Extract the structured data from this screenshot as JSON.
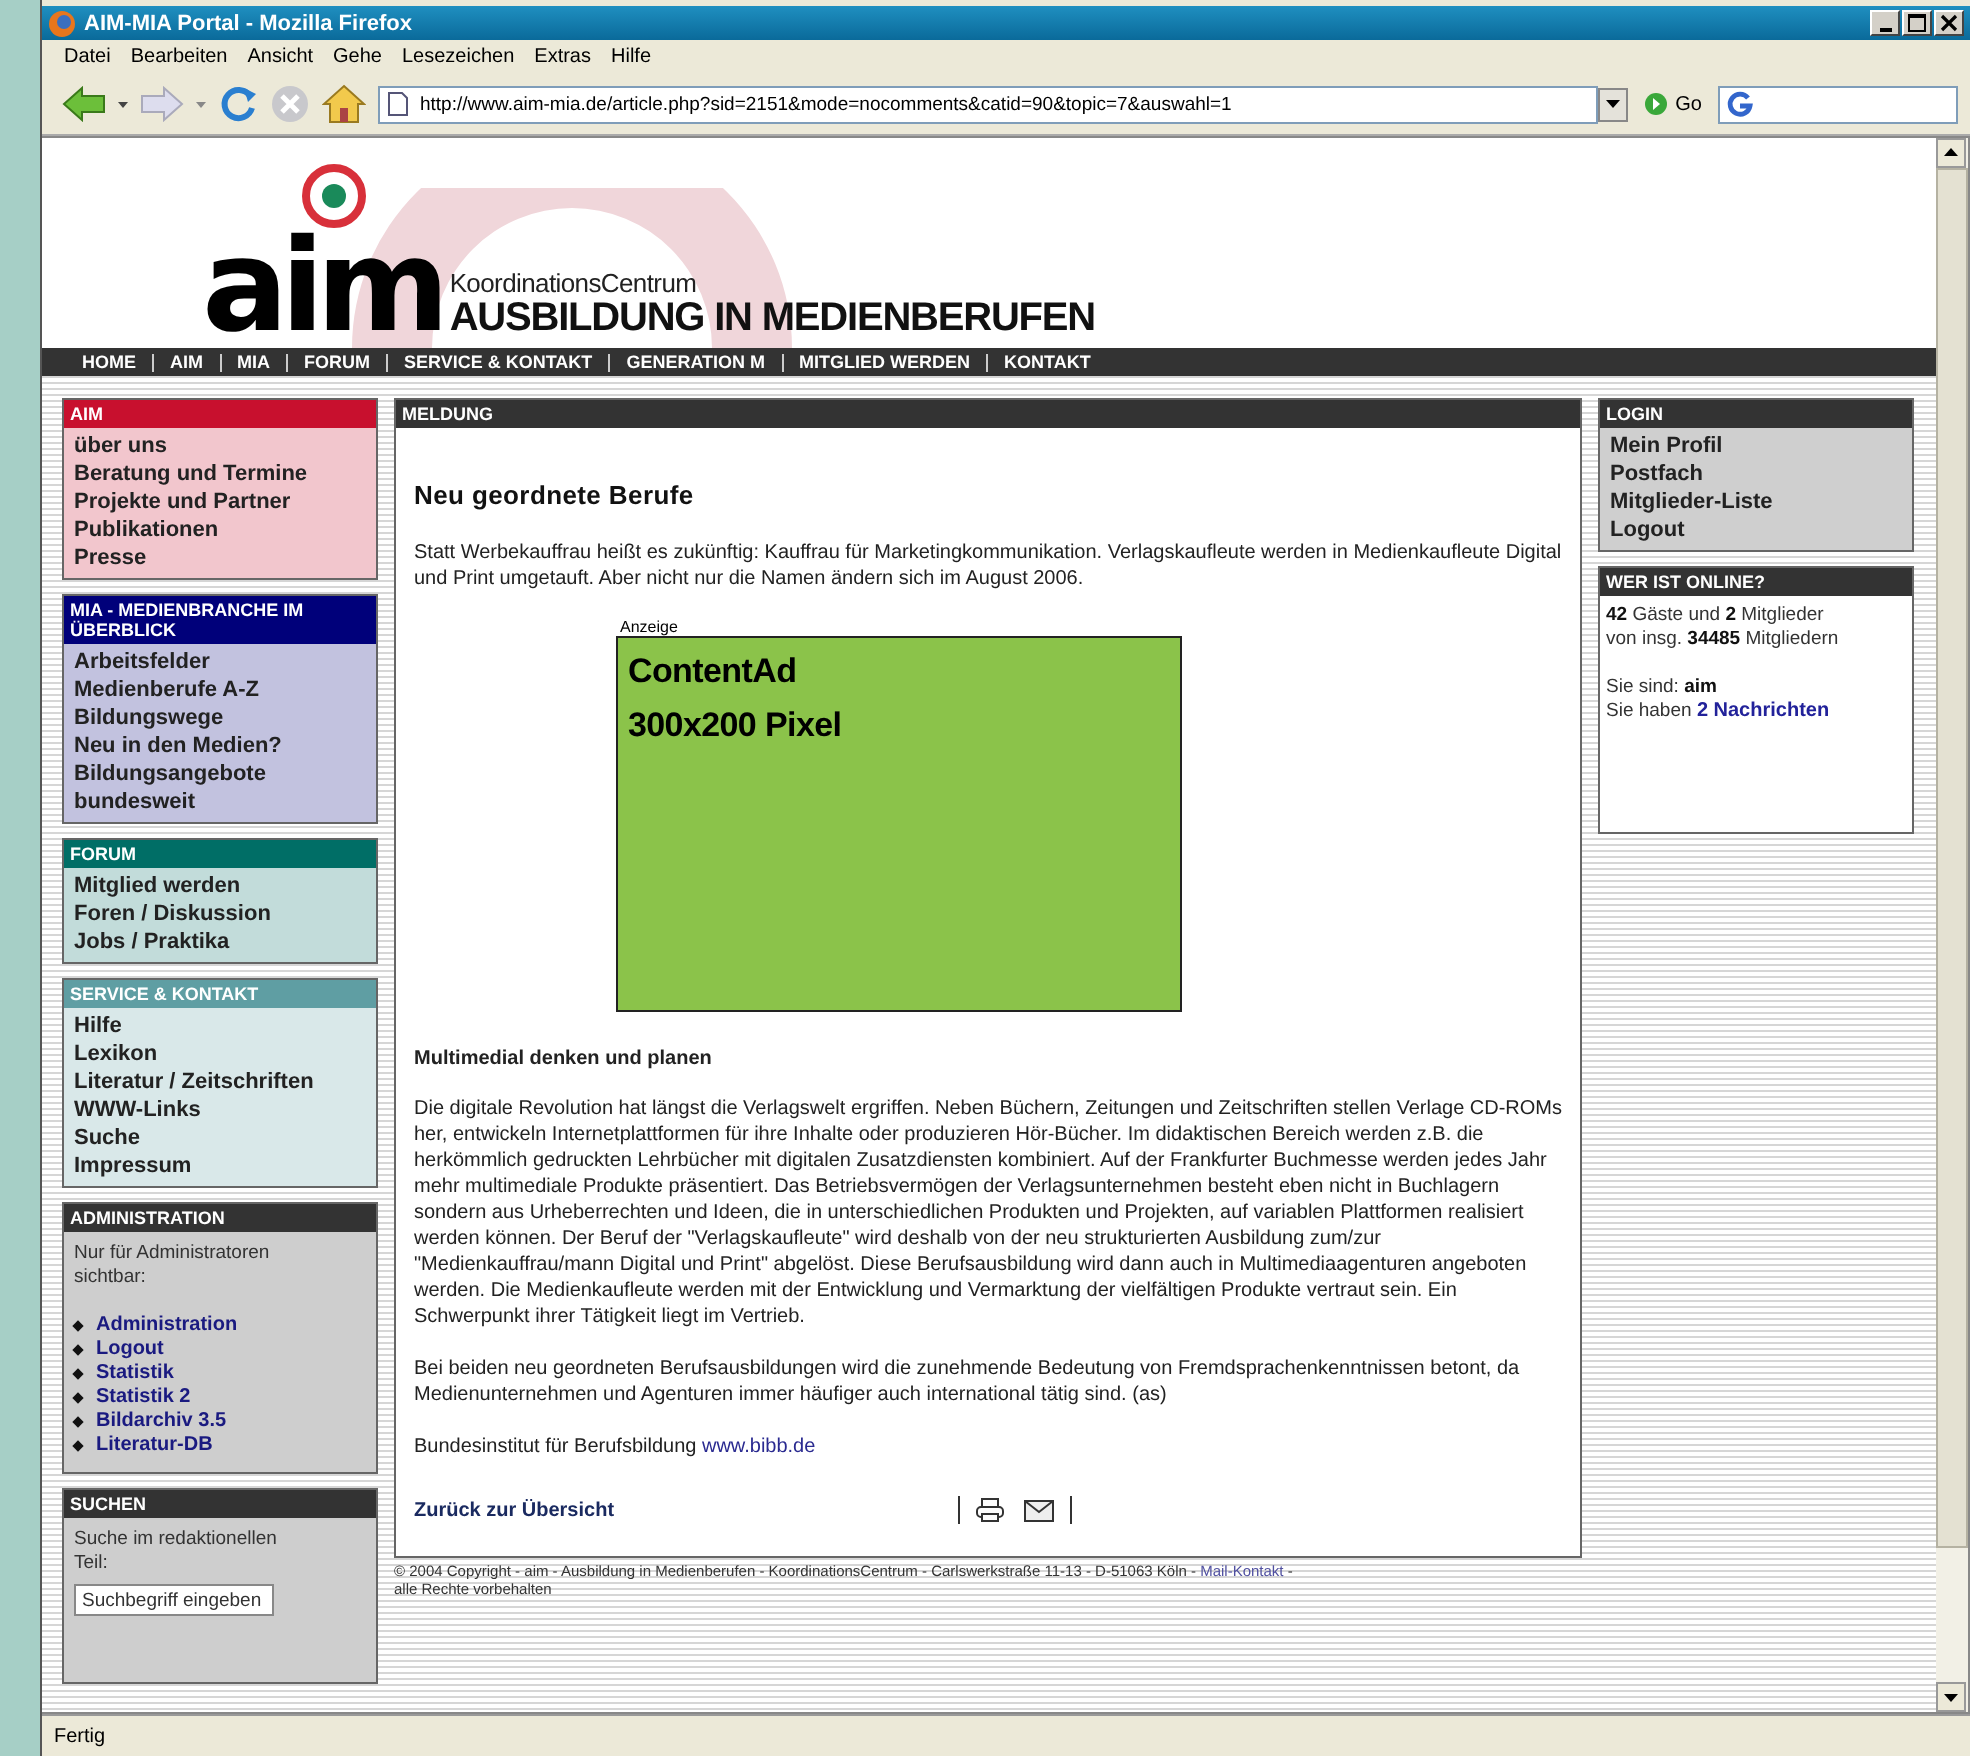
{
  "window": {
    "title": "AIM-MIA Portal - Mozilla Firefox"
  },
  "menu": [
    "Datei",
    "Bearbeiten",
    "Ansicht",
    "Gehe",
    "Lesezeichen",
    "Extras",
    "Hilfe"
  ],
  "toolbar": {
    "url": "http://www.aim-mia.de/article.php?sid=2151&mode=nocomments&catid=90&topic=7&auswahl=1",
    "go": "Go"
  },
  "page": {
    "logo": {
      "mark": "aim",
      "line_1": "KoordinationsCentrum",
      "line_2": "AUSBILDUNG IN MEDIENBERUFEN"
    },
    "nav": [
      "HOME",
      "AIM",
      "MIA",
      "FORUM",
      "SERVICE & KONTAKT",
      "GENERATION M",
      "MITGLIED WERDEN",
      "KONTAKT"
    ],
    "left_boxes": [
      {
        "kind": "links",
        "title": "AIM",
        "color": "#c8102e",
        "items": [
          "über uns",
          "Beratung und Termine",
          "Projekte und Partner",
          "Publikationen",
          "Presse"
        ]
      },
      {
        "kind": "links",
        "title": "MIA - MEDIENBRANCHE IM ÜBERBLICK",
        "color": "#00007a",
        "items": [
          "Arbeitsfelder",
          "Medienberufe A-Z",
          "Bildungswege",
          "Neu in den Medien?",
          "Bildungsangebote bundesweit"
        ]
      },
      {
        "kind": "links",
        "title": "FORUM",
        "color": "#006e66",
        "items": [
          "Mitglied werden",
          "Foren / Diskussion",
          "Jobs / Praktika"
        ]
      },
      {
        "kind": "links",
        "title": "SERVICE & KONTAKT",
        "color": "#5f9ea3",
        "items": [
          "Hilfe",
          "Lexikon",
          "Literatur / Zeitschriften",
          "WWW-Links",
          "Suche",
          "Impressum"
        ]
      },
      {
        "kind": "admin",
        "title": "ADMINISTRATION",
        "color": "#333333",
        "intro": "Nur für Administratoren sichtbar:",
        "items": [
          "Administration",
          "Logout",
          "Statistik",
          "Statistik 2",
          "Bildarchiv 3.5",
          "Literatur-DB"
        ]
      },
      {
        "kind": "search",
        "title": "SUCHEN",
        "color": "#333333",
        "intro": "Suche im redaktionellen Teil:",
        "placeholder": "Suchbegriff eingeben"
      }
    ],
    "article": {
      "header": "MELDUNG",
      "title": "Neu geordnete Berufe",
      "intro": "Statt Werbekauffrau heißt es zukünftig: Kauffrau für Marketingkommunikation. Verlagskaufleute werden in Medienkaufleute Digital und Print umgetauft. Aber nicht nur die Namen ändern sich im August 2006.",
      "ad": {
        "label": "Anzeige",
        "lines": [
          "ContentAd",
          "300x200 Pixel"
        ]
      },
      "subheading": "Multimedial denken und planen",
      "paragraphs": [
        "Die digitale Revolution hat längst die Verlagswelt ergriffen. Neben Büchern, Zeitungen und Zeitschriften stellen Verlage CD-ROMs her, entwickeln Internetplattformen für ihre Inhalte oder produzieren Hör-Bücher. Im didaktischen Bereich werden z.B. die herkömmlich gedruckten Lehrbücher mit digitalen Zusatzdiensten kombiniert. Auf der Frankfurter Buchmesse werden jedes Jahr mehr multimediale Produkte präsentiert. Das Betriebsvermögen der Verlagsunternehmen besteht eben nicht in Buchlagern sondern aus Urheberrechten und Ideen, die in unterschiedlichen Produkten und Projekten, auf variablen Plattformen realisiert werden können. Der Beruf der \"Verlagskaufleute\" wird deshalb von der neu strukturierten Ausbildung zum/zur \"Medienkauffrau/mann Digital und Print\" abgelöst. Diese Berufsausbildung wird dann auch in Multimediaagenturen angeboten werden. Die Medienkaufleute werden mit der Entwicklung und Vermarktung der vielfältigen Produkte vertraut sein. Ein Schwerpunkt ihrer Tätigkeit liegt im Vertrieb.",
        "Bei beiden neu geordneten Berufsausbildungen wird die zunehmende Bedeutung von Fremdsprachenkenntnissen betont, da Medienunternehmen und Agenturen immer häufiger auch international tätig sind. (as)"
      ],
      "source": {
        "text": "Bundesinstitut für Berufsbildung",
        "link": "www.bibb.de"
      },
      "back": "Zurück zur Übersicht"
    },
    "right_boxes": [
      {
        "kind": "links",
        "title": "LOGIN",
        "items": [
          "Mein Profil",
          "Postfach",
          "Mitglieder-Liste",
          "Logout"
        ]
      },
      {
        "kind": "online",
        "title": "WER IST ONLINE?",
        "lines": [
          "**42** Gäste und **2** Mitglieder",
          "von insg. **34485** Mitgliedern"
        ],
        "user": "Sie sind: **aim**",
        "messages": {
          "text": "Sie haben",
          "link": "2 Nachrichten"
        }
      }
    ],
    "footer": {
      "text": "© 2004 Copyright - aim - Ausbildung in Medienberufen - KoordinationsCentrum - Carlswerkstraße 11-13 - D-51063 Köln -",
      "link": "Mail-Kontakt",
      "tail": "-",
      "line_2": "alle Rechte vorbehalten"
    }
  },
  "status_bar": "Fertig"
}
